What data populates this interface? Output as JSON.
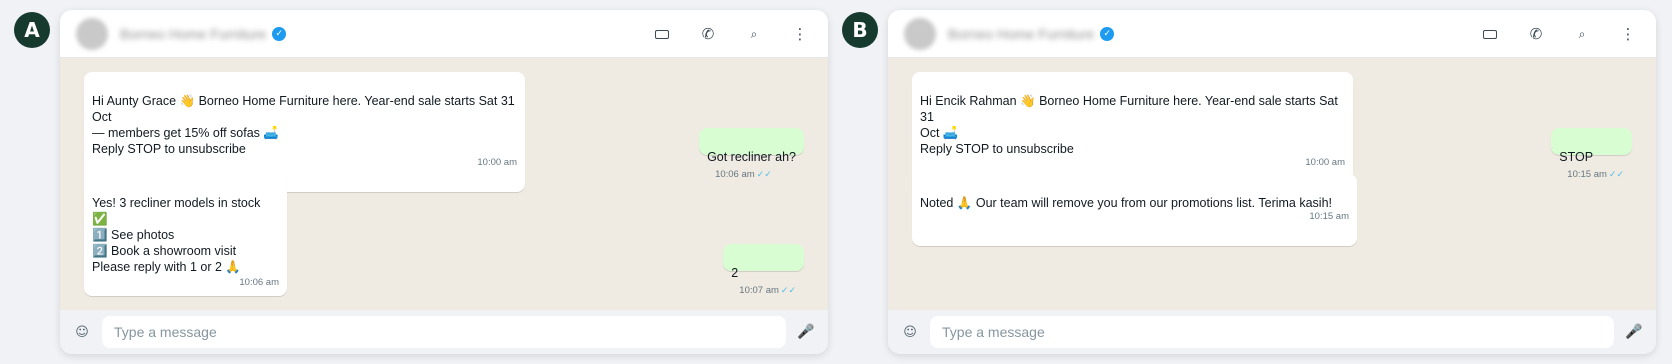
{
  "panels": [
    {
      "label": "A",
      "header": {
        "business_name": "Borneo Home Furniture",
        "verified_icon": "check-badge-icon",
        "icons": [
          "video-icon",
          "phone-icon",
          "search-icon",
          "menu-icon"
        ]
      },
      "messages": [
        {
          "dir": "in",
          "text": "Hi Aunty Grace 👋 Borneo Home Furniture here. Year-end sale starts Sat 31 Oct\n— members get 15% off sofas 🛋️\nReply STOP to unsubscribe",
          "time": "10:00 am"
        },
        {
          "dir": "out",
          "text": "Got recliner ah?",
          "time": "10:06 am",
          "ticks": "✓✓"
        },
        {
          "dir": "in",
          "text": "Yes! 3 recliner models in stock ✅\n1️⃣ See photos\n2️⃣ Book a showroom visit\nPlease reply with 1 or 2 🙏",
          "time": "10:06 am"
        },
        {
          "dir": "out",
          "text": "2",
          "time": "10:07 am",
          "ticks": "✓✓"
        }
      ],
      "composer": {
        "placeholder": "Type a message"
      }
    },
    {
      "label": "B",
      "header": {
        "business_name": "Borneo Home Furniture",
        "verified_icon": "check-badge-icon",
        "icons": [
          "video-icon",
          "phone-icon",
          "search-icon",
          "menu-icon"
        ]
      },
      "messages": [
        {
          "dir": "in",
          "text": "Hi Encik Rahman 👋 Borneo Home Furniture here. Year-end sale starts Sat 31\nOct 🛋️\nReply STOP to unsubscribe",
          "time": "10:00 am"
        },
        {
          "dir": "out",
          "text": "STOP",
          "time": "10:15 am",
          "ticks": "✓✓"
        },
        {
          "dir": "in",
          "text": "Noted 🙏 Our team will remove you from our promotions list. Terima kasih!",
          "time": "10:15 am"
        }
      ],
      "composer": {
        "placeholder": "Type a message"
      }
    }
  ],
  "colors": {
    "badge": "#173a2f",
    "chat_bg": "#efeae2",
    "incoming": "#ffffff",
    "outgoing": "#d9fdd3",
    "ticks": "#53bdeb",
    "verified": "#1d9bf0"
  }
}
